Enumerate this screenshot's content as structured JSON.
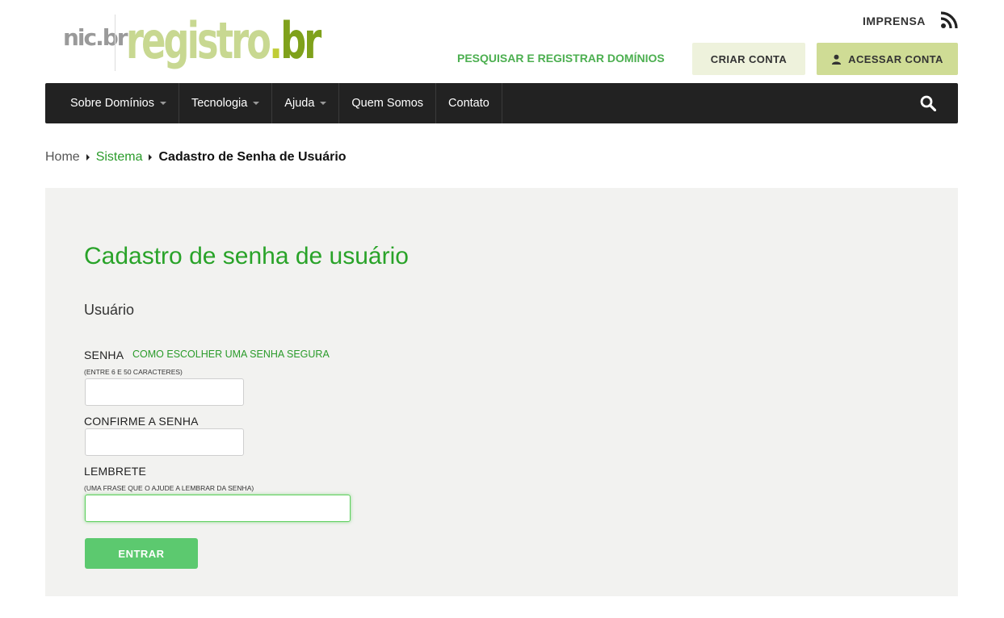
{
  "header": {
    "logo": {
      "nic_text": "nic.br",
      "registro_text": "registro",
      "dot_text": ".",
      "br_text": "br"
    },
    "imprensa_label": "IMPRENSA",
    "search_register_label": "PESQUISAR E REGISTRAR DOMÍNIOS",
    "criar_conta_label": "CRIAR CONTA",
    "acessar_conta_label": "ACESSAR CONTA"
  },
  "nav": {
    "items": [
      {
        "label": "Sobre Domínios",
        "dropdown": true
      },
      {
        "label": "Tecnologia",
        "dropdown": true
      },
      {
        "label": "Ajuda",
        "dropdown": true
      },
      {
        "label": "Quem Somos",
        "dropdown": false
      },
      {
        "label": "Contato",
        "dropdown": false
      }
    ],
    "search_icon": "search-icon"
  },
  "breadcrumb": {
    "home": "Home",
    "sistema": "Sistema",
    "current": "Cadastro de Senha de Usuário"
  },
  "form": {
    "title": "Cadastro de senha de usuário",
    "user_label": "Usuário",
    "senha_label": "SENHA",
    "senha_help_link": "COMO ESCOLHER UMA SENHA SEGURA",
    "senha_hint": "(ENTRE 6 E 50 CARACTERES)",
    "senha_value": "",
    "confirm_label": "CONFIRME A SENHA",
    "confirm_value": "",
    "lembrete_label": "LEMBRETE",
    "lembrete_hint": "(UMA FRASE QUE O AJUDE A LEMBRAR DA SENHA)",
    "lembrete_value": "",
    "submit_label": "ENTRAR"
  },
  "colors": {
    "accent_green": "#29a329",
    "button_green": "#5cc96f",
    "nav_bg": "#222222",
    "panel_bg": "#f2f2f0"
  }
}
